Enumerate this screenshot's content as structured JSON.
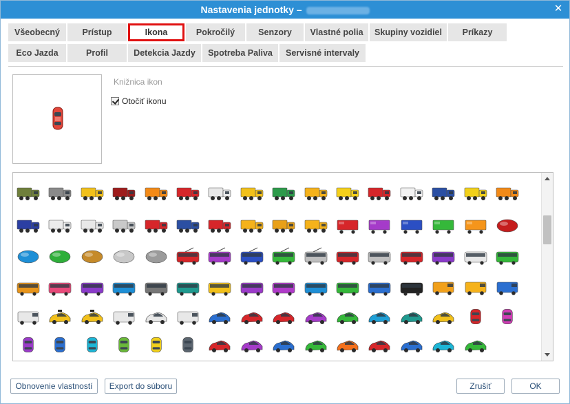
{
  "dialog": {
    "title": "Nastavenia jednotky –",
    "close_glyph": "✕"
  },
  "tabs": [
    {
      "label": "Všeobecný"
    },
    {
      "label": "Prístup"
    },
    {
      "label": "Ikona",
      "active": true
    },
    {
      "label": "Pokročilý"
    },
    {
      "label": "Senzory"
    },
    {
      "label": "Vlastné polia"
    },
    {
      "label": "Skupiny vozidiel"
    },
    {
      "label": "Príkazy"
    },
    {
      "label": "Eco Jazda"
    },
    {
      "label": "Profil"
    },
    {
      "label": "Detekcia Jazdy"
    },
    {
      "label": "Spotreba Paliva"
    },
    {
      "label": "Servisné intervaly"
    }
  ],
  "icon_panel": {
    "library_label": "Knižnica ikon",
    "rotate_label": "Otočiť ikonu",
    "rotate_checked": true,
    "preview_icon": "red-car-top-view-icon"
  },
  "gallery": {
    "rows": [
      [
        "truck-military-green",
        "truck-6x6-gray",
        "truck-yellow",
        "truck-green-red",
        "dump-truck-orange",
        "truck-red",
        "truck-white",
        "truck-yellow-2",
        "truck-green",
        "dump-truck-yellow",
        "dump-truck-yellow-2",
        "truck-white-red",
        "box-truck-white",
        "truck-blue",
        "truck-white-yellow",
        "dump-truck-orange-2"
      ],
      [
        "tractor-blue",
        "tractor-white",
        "tractor-white-red",
        "concrete-mixer",
        "truck-red-2",
        "tractor-blue-2",
        "tractor-red",
        "excavator-yellow",
        "dumper-yellow",
        "dumper-yellow-2",
        "trailer-red",
        "trailer-purple",
        "trailer-blue",
        "trailer-green",
        "trailer-orange",
        "tank-red"
      ],
      [
        "tank-blue",
        "tank-green",
        "tank-orange",
        "tank-silver",
        "tank-wagon",
        "trolleybus-red",
        "trolleybus-purple",
        "trolleybus-blue",
        "trolleybus-green",
        "trolleybus-silver",
        "tram-red",
        "bus-silver",
        "bus-red",
        "bus-purple",
        "bus-white",
        "bus-green"
      ],
      [
        "bus-orange",
        "bus-pink",
        "bus-purple-2",
        "bus-blue",
        "bus-gray",
        "bus-teal",
        "bus-yellow",
        "bus-purple-3",
        "bus-purple-4",
        "bus-blue-2",
        "bus-green-2",
        "train-blue",
        "train-black",
        "van-orange",
        "van-yellow",
        "van-blue"
      ],
      [
        "van-white",
        "taxi-yellow",
        "taxi-yellow-2",
        "pickup-white",
        "car-white",
        "box-van-white",
        "car-blue",
        "car-red",
        "car-red-2",
        "car-purple",
        "car-green",
        "car-cyan",
        "car-teal",
        "car-yellow",
        "car-top-red",
        "car-top-pink"
      ],
      [
        "car-top-purple",
        "car-top-blue",
        "car-top-cyan",
        "car-top-green",
        "car-top-yellow",
        "car-top-gray",
        "sports-car-red",
        "sports-car-purple",
        "sports-car-blue",
        "sports-car-green",
        "sports-car-orange",
        "sports-car-red-2",
        "sports-car-blue-2",
        "sports-car-cyan",
        "sports-car-green-2"
      ]
    ],
    "colors": {
      "row0": [
        "#6f7f3b",
        "#8a8a8a",
        "#f1c01b",
        "#9e1c1c",
        "#f28a18",
        "#d6262a",
        "#e9e9e9",
        "#f1c01b",
        "#2d9a4a",
        "#f5b21b",
        "#f5d01b",
        "#d6262a",
        "#f2f2f2",
        "#2b4fa3",
        "#f1d01b",
        "#f28a18"
      ],
      "row1": [
        "#2b3fa3",
        "#ececec",
        "#e8e8e8",
        "#c9c9c9",
        "#d6262a",
        "#2b4fa3",
        "#d6262a",
        "#f5b21b",
        "#e8a018",
        "#f5b21b",
        "#d6262a",
        "#a53bc9",
        "#2b4fc3",
        "#35b83a",
        "#f5951b",
        "#c51d1d"
      ],
      "row2": [
        "#1e8fd6",
        "#2fae3a",
        "#c58a2a",
        "#c8c8c8",
        "#9b9b9b",
        "#d6262a",
        "#a53bc9",
        "#2b4fc3",
        "#35b83a",
        "#bfbfbf",
        "#d6262a",
        "#bfbfbf",
        "#d6262a",
        "#8a3bc9",
        "#e8e8e8",
        "#35b83a"
      ],
      "row3": [
        "#e8951b",
        "#e84a7a",
        "#8a3bc9",
        "#1e8fd6",
        "#777777",
        "#1f9a8f",
        "#f1c01b",
        "#9b3bc9",
        "#b03bc9",
        "#1e8fd6",
        "#35b83a",
        "#2b6fd0",
        "#222222",
        "#f1a01b",
        "#f5b21b",
        "#2b6fd0"
      ],
      "row4": [
        "#e8e8e8",
        "#f1c01b",
        "#f1c01b",
        "#e8e8e8",
        "#e8e8e8",
        "#e8e8e8",
        "#2b6fd0",
        "#d6262a",
        "#d6262a",
        "#a53bc9",
        "#35b83a",
        "#1e9fd6",
        "#1f9a8f",
        "#f1c01b",
        "#d6262a",
        "#d13bb5"
      ],
      "row5": [
        "#9b3bc9",
        "#2b6fd0",
        "#1eb6d6",
        "#6ab83a",
        "#f1d01b",
        "#5c6670",
        "#d6262a",
        "#a53bc9",
        "#2b6fd0",
        "#35b83a",
        "#f5701b",
        "#d6262a",
        "#2b6fd0",
        "#1eb6d6",
        "#35b83a"
      ]
    }
  },
  "footer": {
    "reset_label": "Obnovenie vlastností",
    "export_label": "Export do súboru",
    "cancel_label": "Zrušiť",
    "ok_label": "OK"
  }
}
